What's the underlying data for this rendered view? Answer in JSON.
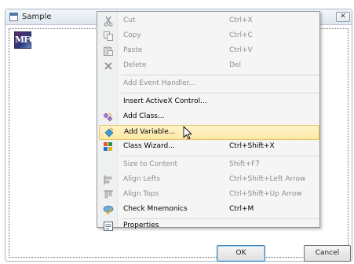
{
  "window": {
    "title": "Sample",
    "close_glyph": "✕",
    "app_icon_text": "MFC",
    "ok_label": "OK",
    "cancel_label": "Cancel"
  },
  "menu": {
    "items": [
      {
        "label": "Cut",
        "shortcut": "Ctrl+X",
        "enabled": false,
        "icon": "cut-icon"
      },
      {
        "label": "Copy",
        "shortcut": "Ctrl+C",
        "enabled": false,
        "icon": "copy-icon"
      },
      {
        "label": "Paste",
        "shortcut": "Ctrl+V",
        "enabled": false,
        "icon": "paste-icon"
      },
      {
        "label": "Delete",
        "shortcut": "Del",
        "enabled": false,
        "icon": "delete-icon"
      },
      {
        "label": "Add Event Handler...",
        "shortcut": "",
        "enabled": false,
        "icon": ""
      },
      {
        "label": "Insert ActiveX Control...",
        "shortcut": "",
        "enabled": true,
        "icon": ""
      },
      {
        "label": "Add Class...",
        "shortcut": "",
        "enabled": true,
        "icon": "add-class-icon"
      },
      {
        "label": "Add Variable...",
        "shortcut": "",
        "enabled": true,
        "highlighted": true,
        "icon": "add-variable-icon"
      },
      {
        "label": "Class Wizard...",
        "shortcut": "Ctrl+Shift+X",
        "enabled": true,
        "icon": "class-wizard-icon"
      },
      {
        "label": "Size to Content",
        "shortcut": "Shift+F7",
        "enabled": false,
        "icon": ""
      },
      {
        "label": "Align Lefts",
        "shortcut": "Ctrl+Shift+Left Arrow",
        "enabled": false,
        "icon": "align-lefts-icon"
      },
      {
        "label": "Align Tops",
        "shortcut": "Ctrl+Shift+Up Arrow",
        "enabled": false,
        "icon": "align-tops-icon"
      },
      {
        "label": "Check Mnemonics",
        "shortcut": "Ctrl+M",
        "enabled": true,
        "icon": "check-mnemonics-icon"
      },
      {
        "label": "Properties",
        "shortcut": "",
        "enabled": true,
        "icon": "properties-icon"
      }
    ]
  },
  "colors": {
    "highlight_top": "#fff3cc",
    "highlight_bottom": "#fde7a3",
    "disabled_text": "#8d8d8d"
  }
}
